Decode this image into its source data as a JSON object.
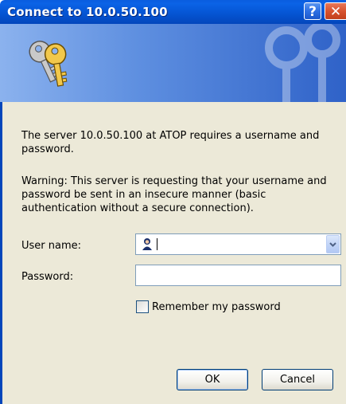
{
  "window": {
    "title": "Connect to 10.0.50.100",
    "help_label": "?",
    "close_label": "✕"
  },
  "message": {
    "line1": "The server 10.0.50.100 at ATOP requires a username and password.",
    "warning": "Warning: This server is requesting that your username and password be sent in an insecure manner (basic authentication without a secure connection)."
  },
  "form": {
    "username_label": "User name:",
    "username_value": "",
    "password_label": "Password:",
    "password_value": "",
    "remember_label": "Remember my password",
    "remember_checked": false
  },
  "buttons": {
    "ok": "OK",
    "cancel": "Cancel"
  },
  "icons": {
    "banner": "keys-icon",
    "user": "user-icon",
    "dropdown": "chevron-down-icon"
  },
  "colors": {
    "titlebar": "#0555d4",
    "banner_left": "#8bb2ee",
    "banner_right": "#2f62c8",
    "dialog_bg": "#ece9d8"
  }
}
